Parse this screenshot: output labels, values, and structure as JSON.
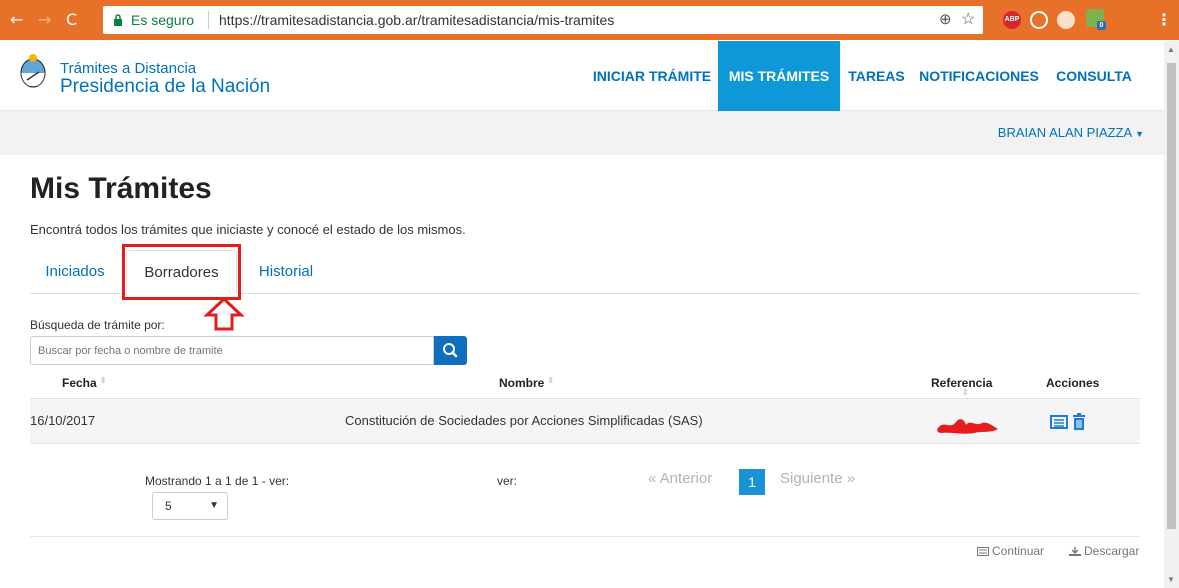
{
  "browser": {
    "security_label": "Es seguro",
    "url": "https://tramitesadistancia.gob.ar/tramitesadistancia/mis-tramites",
    "ext_abp": "ABP",
    "ext_badge": "0"
  },
  "header": {
    "brand_top": "Trámites a Distancia",
    "brand_bottom": "Presidencia de la Nación",
    "nav": [
      "INICIAR TRÁMITE",
      "MIS TRÁMITES",
      "TAREAS",
      "NOTIFICACIONES",
      "CONSULTA"
    ],
    "active_nav": "MIS TRÁMITES"
  },
  "userbar": {
    "username": "BRAIAN ALAN PIAZZA"
  },
  "main": {
    "title": "Mis Trámites",
    "intro": "Encontrá todos los trámites que iniciaste y conocé el estado de los mismos.",
    "tabs": [
      "Iniciados",
      "Borradores",
      "Historial"
    ],
    "active_tab": "Borradores",
    "search_label": "Búsqueda de trámite por:",
    "search_placeholder": "Buscar por fecha o nombre de tramite"
  },
  "table": {
    "headers": [
      "Fecha",
      "Nombre",
      "Referencia",
      "Acciones"
    ],
    "rows": [
      {
        "fecha": "16/10/2017",
        "nombre": "Constitución de Sociedades por Acciones Simplificadas (SAS)"
      }
    ]
  },
  "pagination": {
    "showing": "Mostrando 1 a 1 de 1 - ver:",
    "page_size": "5",
    "ver": "ver:",
    "prev": "« Anterior",
    "current": "1",
    "next": "Siguiente »"
  },
  "footer": {
    "continuar": "Continuar",
    "descargar": "Descargar"
  },
  "colors": {
    "chrome": "#e8712a",
    "brand_blue": "#0072bb",
    "active_nav": "#0f98d8",
    "highlight_red": "#e11d1d"
  }
}
